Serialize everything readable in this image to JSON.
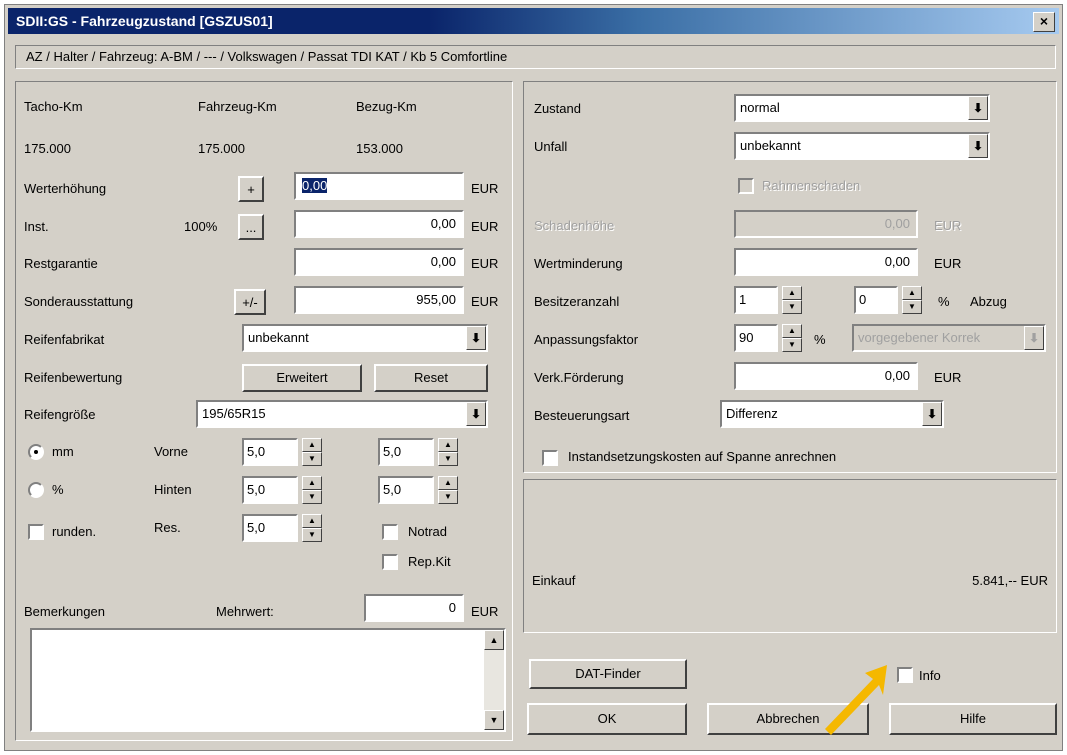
{
  "window": {
    "title": "SDII:GS - Fahrzeugzustand [GSZUS01]",
    "close": "×"
  },
  "breadcrumb": "AZ / Halter / Fahrzeug: A-BM / --- / Volkswagen / Passat TDI KAT / Kb 5 Comfortline",
  "left": {
    "km_headers": [
      "Tacho-Km",
      "Fahrzeug-Km",
      "Bezug-Km"
    ],
    "km_values": [
      "175.000",
      "175.000",
      "153.000"
    ],
    "werterhoehung": {
      "label": "Werterhöhung",
      "button": "+",
      "value": "0,00",
      "unit": "EUR"
    },
    "inst": {
      "label": "Inst.",
      "percent": "100%",
      "button": "...",
      "value": "0,00",
      "unit": "EUR"
    },
    "restgarantie": {
      "label": "Restgarantie",
      "value": "0,00",
      "unit": "EUR"
    },
    "sonderausstattung": {
      "label": "Sonderausstattung",
      "button": "+/-",
      "value": "955,00",
      "unit": "EUR"
    },
    "reifenfabrikat": {
      "label": "Reifenfabrikat",
      "value": "unbekannt"
    },
    "reifenbewertung": {
      "label": "Reifenbewertung",
      "btn_erweitert": "Erweitert",
      "btn_reset": "Reset"
    },
    "reifengroesse": {
      "label": "Reifengröße",
      "value": "195/65R15"
    },
    "mm_label": "mm",
    "pct_label": "%",
    "vorne_label": "Vorne",
    "hinten_label": "Hinten",
    "vorne": [
      "5,0",
      "5,0"
    ],
    "hinten": [
      "5,0",
      "5,0"
    ],
    "runden_label": "runden.",
    "res_label": "Res.",
    "res_value": "5,0",
    "notrad": "Notrad",
    "repkit": "Rep.Kit",
    "bemerkungen": "Bemerkungen",
    "mehrwert": {
      "label": "Mehrwert:",
      "value": "0",
      "unit": "EUR"
    }
  },
  "right": {
    "zustand": {
      "label": "Zustand",
      "value": "normal"
    },
    "unfall": {
      "label": "Unfall",
      "value": "unbekannt"
    },
    "rahmenschaden": "Rahmenschaden",
    "schadenhoehe": {
      "label": "Schadenhöhe",
      "value": "0,00",
      "unit": "EUR"
    },
    "wertminderung": {
      "label": "Wertminderung",
      "value": "0,00",
      "unit": "EUR"
    },
    "besitzeranzahl": {
      "label": "Besitzeranzahl",
      "value": "1",
      "abzug_value": "0",
      "pct": "%",
      "abzug": "Abzug"
    },
    "anpassungsfaktor": {
      "label": "Anpassungsfaktor",
      "value": "90",
      "pct": "%",
      "korrektur": "vorgegebener Korrek"
    },
    "verk_foerderung": {
      "label": "Verk.Förderung",
      "value": "0,00",
      "unit": "EUR"
    },
    "besteuerungsart": {
      "label": "Besteuerungsart",
      "value": "Differenz"
    },
    "instandsetzung": "Instandsetzungskosten auf Spanne anrechnen",
    "einkauf": {
      "label": "Einkauf",
      "value": "5.841,-- EUR"
    }
  },
  "buttons": {
    "dat_finder": "DAT-Finder",
    "info": "Info",
    "ok": "OK",
    "abbrechen": "Abbrechen",
    "hilfe": "Hilfe"
  },
  "colors": {
    "annotation_arrow": "#f5b800"
  }
}
